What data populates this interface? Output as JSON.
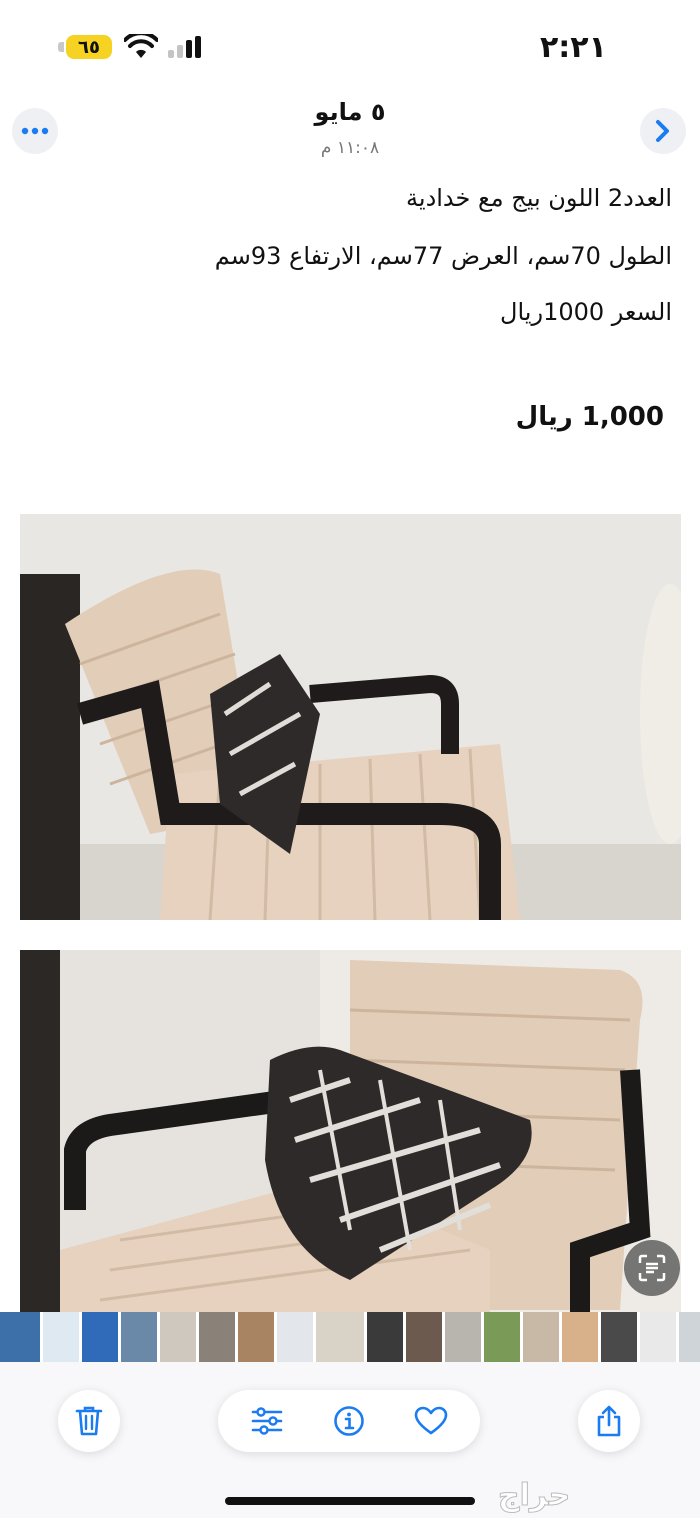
{
  "status_bar": {
    "time": "٢:٢١",
    "battery": "٦٥"
  },
  "header": {
    "date": "٥ مايو",
    "time": "١١:٠٨ م"
  },
  "description": {
    "line1": "العدد2 اللون بيج مع خدادية",
    "line2": "الطول 70سم، العرض 77سم، الارتفاع 93سم",
    "line3": "السعر 1000ريال"
  },
  "price": "1,000 ريال",
  "photos": [
    {
      "icon": "beige-chair-photo-1"
    },
    {
      "icon": "beige-chair-photo-2"
    }
  ],
  "thumbnails": [
    {
      "color": "#3d6fa8"
    },
    {
      "color": "#dfe9f2"
    },
    {
      "color": "#2f6bb8"
    },
    {
      "color": "#6a88a8"
    },
    {
      "color": "#cfc8bf"
    },
    {
      "color": "#8a8178"
    },
    {
      "color": "#a98463"
    },
    {
      "color": "#e3e6ea"
    },
    {
      "color": "#d9d2c7"
    },
    {
      "color": "#3a3a3a"
    },
    {
      "color": "#6b5a4d"
    },
    {
      "color": "#b8b4ae"
    },
    {
      "color": "#7a9a58"
    },
    {
      "color": "#c7b9a5"
    },
    {
      "color": "#d8b08a"
    },
    {
      "color": "#4a4a4a"
    },
    {
      "color": "#e9e9e9"
    },
    {
      "color": "#cfd4d8"
    }
  ],
  "toolbar": {
    "icons": [
      "trash-icon",
      "adjust-icon",
      "info-icon",
      "heart-icon",
      "share-icon"
    ]
  },
  "watermark": "حراج",
  "accent_color": "#1a7cf0"
}
